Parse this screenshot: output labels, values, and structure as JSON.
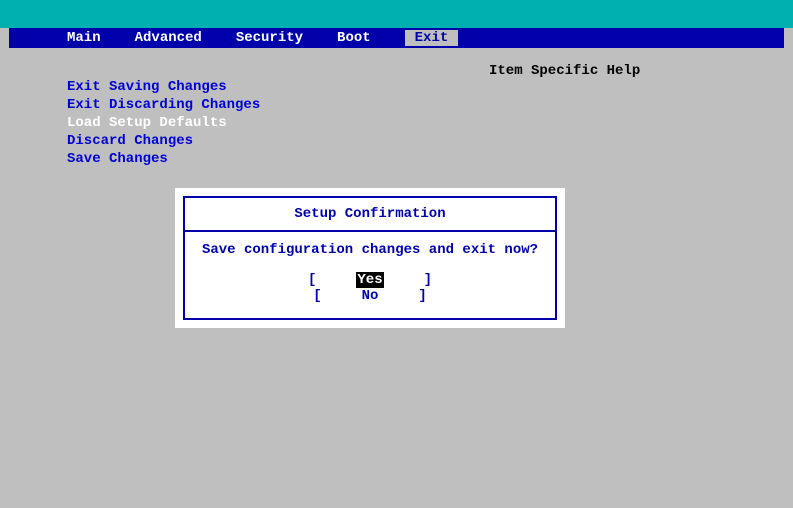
{
  "menu": {
    "items": [
      {
        "label": "Main"
      },
      {
        "label": "Advanced"
      },
      {
        "label": "Security"
      },
      {
        "label": "Boot"
      },
      {
        "label": "Exit",
        "active": true
      }
    ]
  },
  "exit_options": [
    {
      "label": "Exit Saving Changes"
    },
    {
      "label": "Exit Discarding Changes"
    },
    {
      "label": "Load Setup Defaults",
      "selected": true
    },
    {
      "label": "Discard Changes"
    },
    {
      "label": "Save Changes"
    }
  ],
  "help": {
    "title": "Item Specific Help"
  },
  "dialog": {
    "title": "Setup Confirmation",
    "message": "Save configuration changes and exit now?",
    "yes_label": "Yes",
    "no_label": "No"
  }
}
